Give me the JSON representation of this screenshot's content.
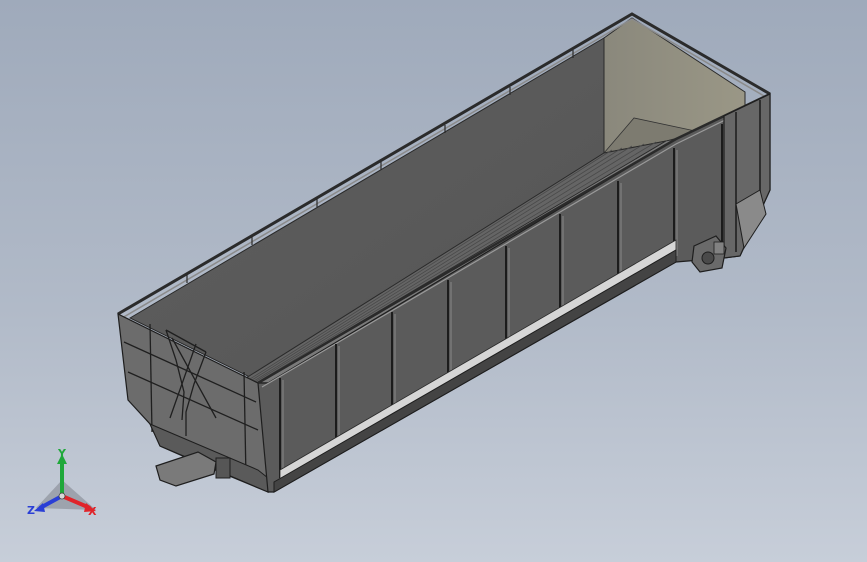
{
  "viewport": {
    "model": "gondola-railcar-model",
    "colors": {
      "background_top": "#9faabb",
      "background_bottom": "#c7ced9",
      "body_dark": "#595959",
      "body_mid": "#6a6a6a",
      "interior_light": "#8e8c80",
      "edge": "#1e1e1e"
    }
  },
  "triad": {
    "x_label": "X",
    "y_label": "Y",
    "z_label": "Z",
    "x_color": "#e0242a",
    "y_color": "#1fa83a",
    "z_color": "#2a3fd6"
  }
}
